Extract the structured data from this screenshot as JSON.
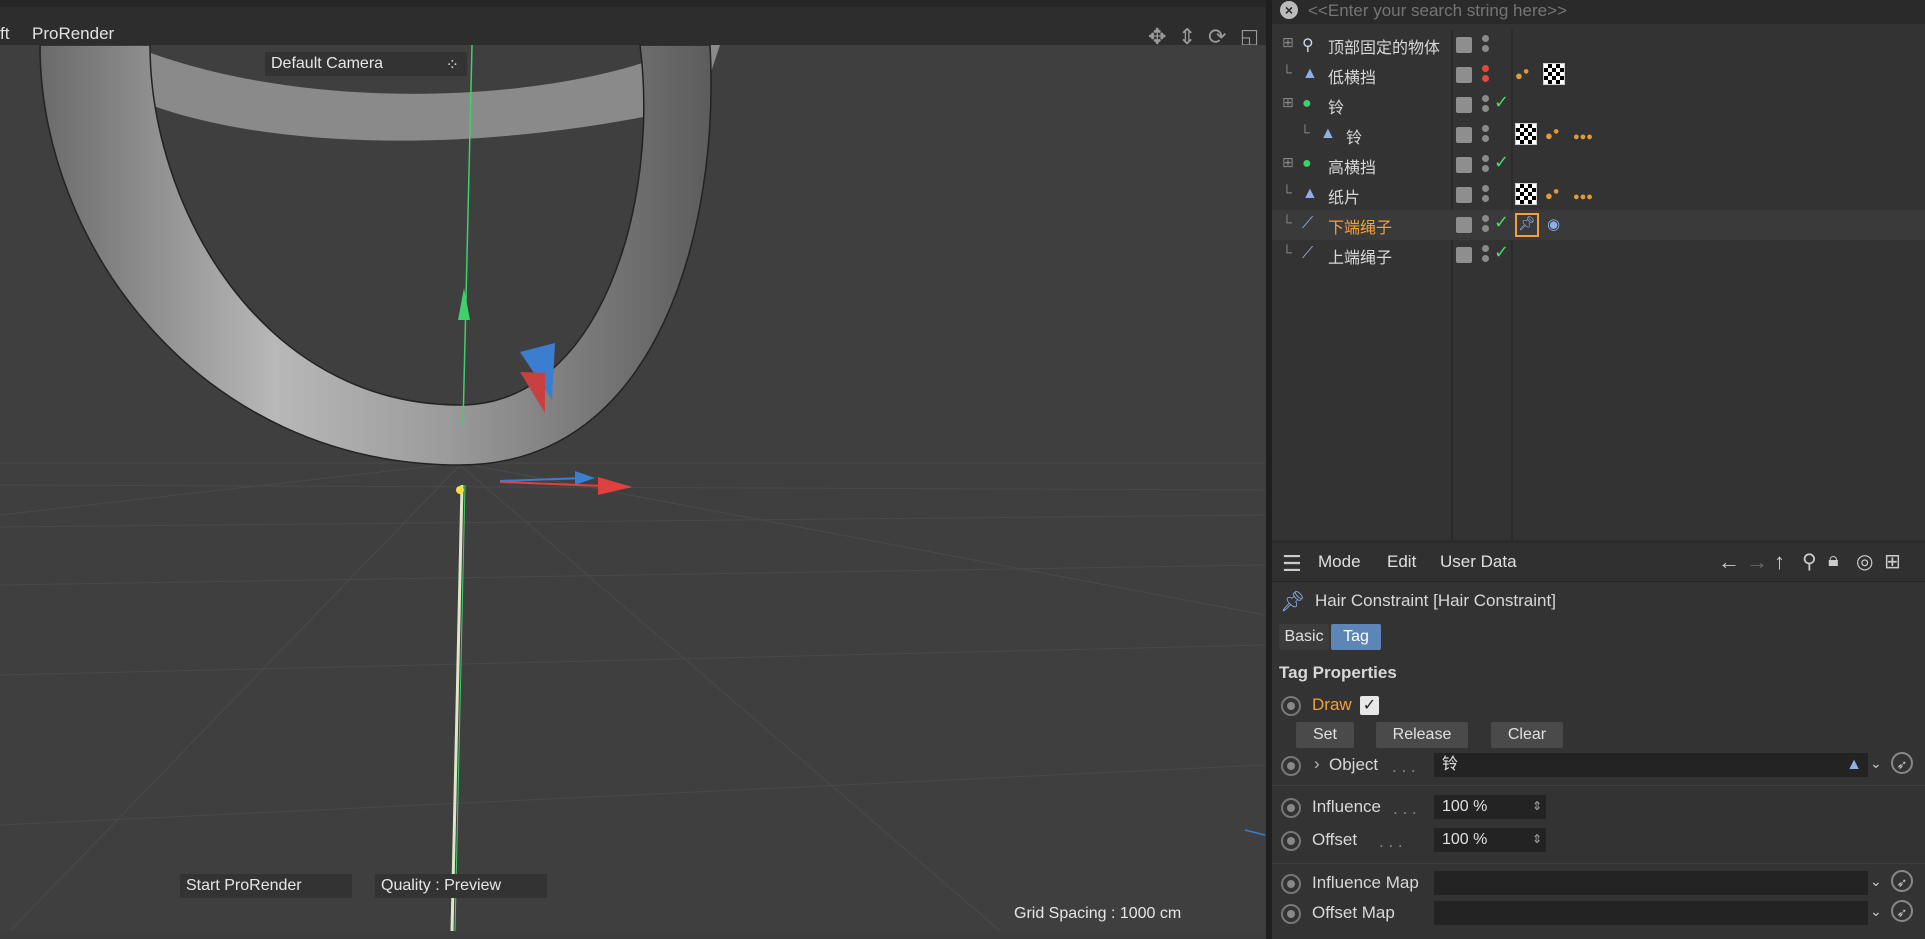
{
  "viewport": {
    "menu": {
      "left_fragment": "ft",
      "prorender": "ProRender"
    },
    "camera_label": "Default Camera",
    "start_prorender": "Start ProRender",
    "quality": "Quality : Preview",
    "grid_spacing": "Grid Spacing : 1000 cm"
  },
  "object_manager": {
    "search_placeholder": "<<Enter your search string here>>",
    "rows": [
      {
        "name": "顶部固定的物体",
        "type": "null-object",
        "checked": false,
        "dot_color": "#8a8a8a",
        "tags": []
      },
      {
        "name": "低横挡",
        "type": "polygon-object",
        "checked": false,
        "dot_color": "#e04a3a",
        "tags": [
          "sphere-tag",
          "material-tag"
        ]
      },
      {
        "name": "铃",
        "type": "sphere-object",
        "checked": true,
        "dot_color": "#8a8a8a",
        "tags": []
      },
      {
        "name": "铃",
        "type": "polygon-object",
        "checked": false,
        "dot_color": "#8a8a8a",
        "tags": [
          "material-tag",
          "sphere-tag",
          "triple-sphere-tag"
        ]
      },
      {
        "name": "高横挡",
        "type": "sphere-object",
        "checked": true,
        "dot_color": "#8a8a8a",
        "tags": []
      },
      {
        "name": "纸片",
        "type": "polygon-object",
        "checked": false,
        "dot_color": "#8a8a8a",
        "tags": [
          "material-tag",
          "sphere-tag",
          "triple-sphere-tag"
        ]
      },
      {
        "name": "下端绳子",
        "type": "spline-object",
        "checked": true,
        "dot_color": "#8a8a8a",
        "tags": [
          "hair-constraint-tag",
          "hair-dynamics-tag"
        ],
        "selected": true
      },
      {
        "name": "上端绳子",
        "type": "spline-object",
        "checked": true,
        "dot_color": "#8a8a8a",
        "tags": []
      }
    ]
  },
  "attribute_manager": {
    "menu": {
      "mode": "Mode",
      "edit": "Edit",
      "user_data": "User Data"
    },
    "title": "Hair Constraint [Hair Constraint]",
    "tabs": {
      "basic": "Basic",
      "tag": "Tag"
    },
    "section": "Tag Properties",
    "draw_label": "Draw",
    "buttons": {
      "set": "Set",
      "release": "Release",
      "clear": "Clear"
    },
    "object_label": "Object",
    "object_value": "铃",
    "influence_label": "Influence",
    "influence_value": "100 %",
    "offset_label": "Offset",
    "offset_value": "100 %",
    "influence_map_label": "Influence Map",
    "offset_map_label": "Offset Map",
    "dotted_leader": ". . ."
  },
  "colors": {
    "accent_orange": "#f0a040",
    "selected_tab": "#5d85b7",
    "check_green": "#4cd964"
  }
}
